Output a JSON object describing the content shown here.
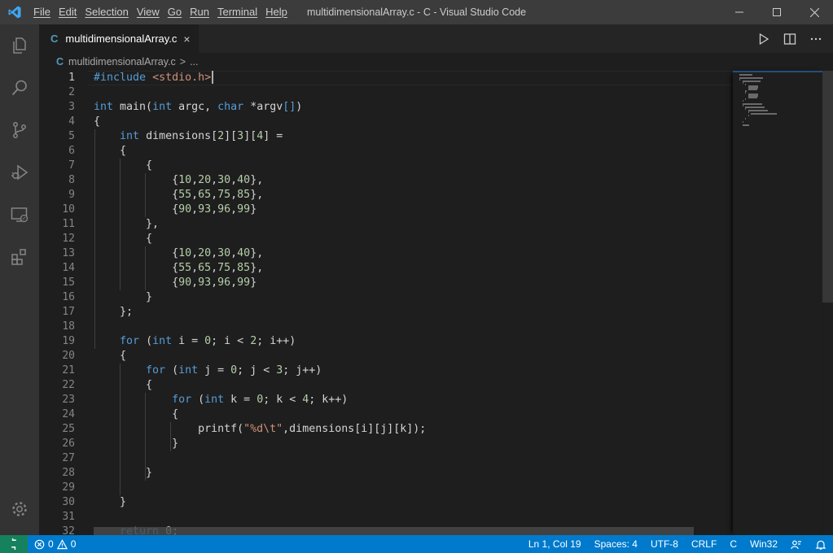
{
  "titlebar": {
    "menu": [
      "File",
      "Edit",
      "Selection",
      "View",
      "Go",
      "Run",
      "Terminal",
      "Help"
    ],
    "window_title": "multidimensionalArray.c - C - Visual Studio Code"
  },
  "activitybar": {
    "items": [
      "explorer-icon",
      "search-icon",
      "source-control-icon",
      "run-debug-icon",
      "remote-explorer-icon",
      "extensions-icon"
    ],
    "bottom": "gear-icon"
  },
  "tabs": [
    {
      "lang": "C",
      "label": "multidimensionalArray.c",
      "close": "×"
    }
  ],
  "breadcrumb": {
    "lang": "C",
    "file": "multidimensionalArray.c",
    "separator": ">",
    "more": "..."
  },
  "editor": {
    "line_numbers": [
      "1",
      "2",
      "3",
      "4",
      "5",
      "6",
      "7",
      "8",
      "9",
      "10",
      "11",
      "12",
      "13",
      "14",
      "15",
      "16",
      "17",
      "18",
      "19",
      "20",
      "21",
      "22",
      "23",
      "24",
      "25",
      "26",
      "27",
      "28",
      "29",
      "30",
      "31",
      "32"
    ]
  },
  "statusbar": {
    "errors": "0",
    "warnings": "0",
    "position": "Ln 1, Col 19",
    "spaces": "Spaces: 4",
    "encoding": "UTF-8",
    "eol": "CRLF",
    "language": "C",
    "platform": "Win32"
  },
  "colors": {
    "accent": "#007acc",
    "remote": "#16825d",
    "keyword": "#569cd6",
    "string": "#ce9178",
    "number": "#b5cea8",
    "title_bar": "#3c3c3c",
    "activity_bar": "#333333"
  }
}
